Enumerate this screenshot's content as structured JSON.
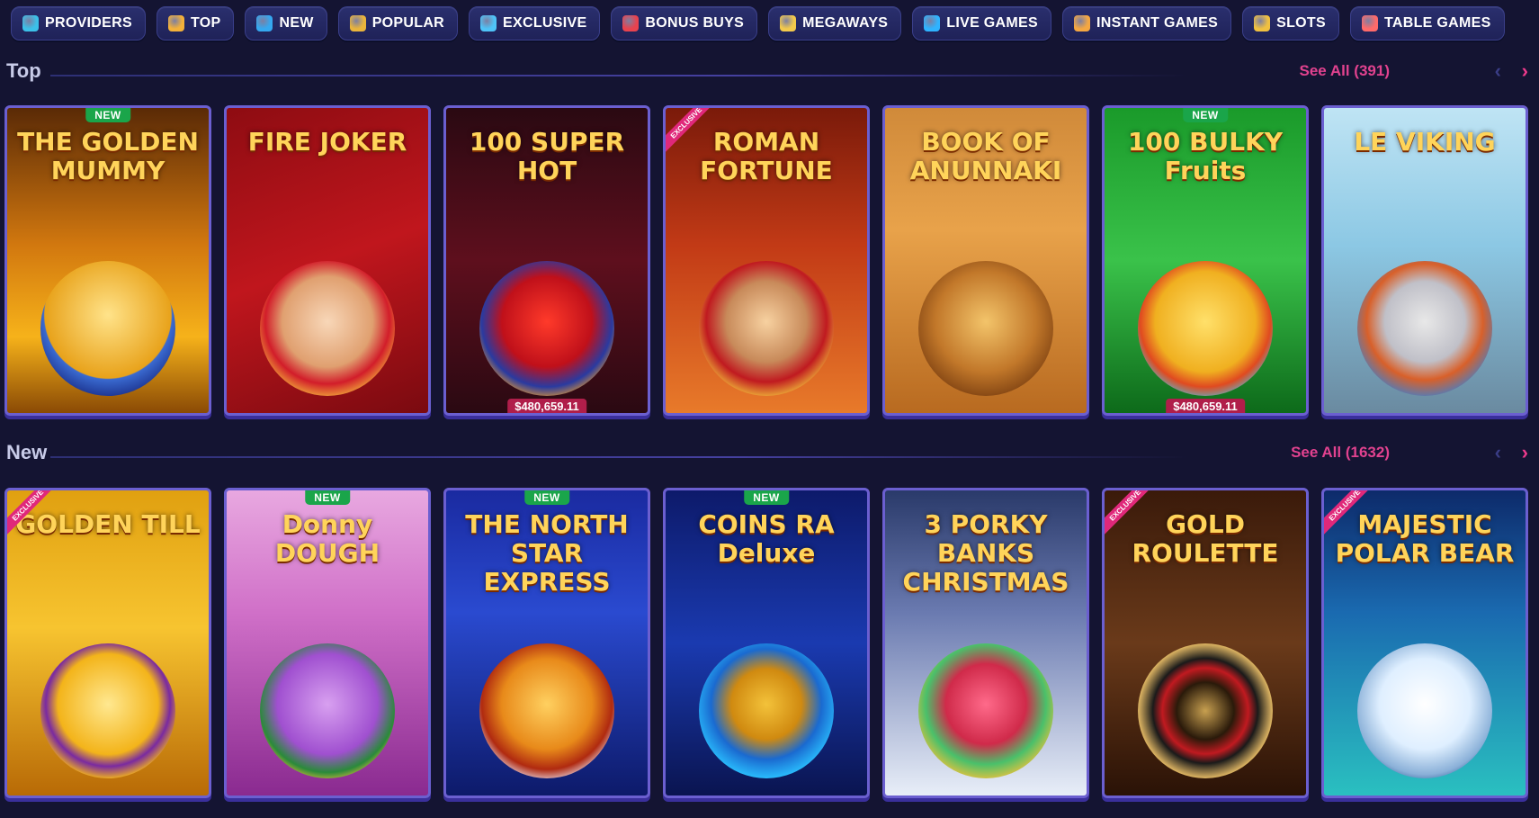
{
  "nav": {
    "items": [
      {
        "label": "PROVIDERS",
        "icon": "providers-icon",
        "color": "#3cc0e8"
      },
      {
        "label": "TOP",
        "icon": "trophy-icon",
        "color": "#f3b13a"
      },
      {
        "label": "NEW",
        "icon": "sparkle-icon",
        "color": "#35a8f0"
      },
      {
        "label": "POPULAR",
        "icon": "shield-star-icon",
        "color": "#e9b43c"
      },
      {
        "label": "EXCLUSIVE",
        "icon": "diamond-icon",
        "color": "#4fc3f7"
      },
      {
        "label": "BONUS BUYS",
        "icon": "gift-icon",
        "color": "#e8434f"
      },
      {
        "label": "MEGAWAYS",
        "icon": "megaways-icon",
        "color": "#f2c94c"
      },
      {
        "label": "LIVE GAMES",
        "icon": "live-icon",
        "color": "#2fb3ff"
      },
      {
        "label": "INSTANT GAMES",
        "icon": "joystick-icon",
        "color": "#f4a742"
      },
      {
        "label": "SLOTS",
        "icon": "slot-machine-icon",
        "color": "#f0c040"
      },
      {
        "label": "TABLE GAMES",
        "icon": "cards-icon",
        "color": "#ff6a6a"
      }
    ]
  },
  "sections": {
    "top": {
      "title": "Top",
      "see_all": "See All (391)",
      "games": [
        {
          "name": "THE GOLDEN MUMMY",
          "badge": "NEW",
          "jackpot": "",
          "bg": "linear-gradient(180deg,#5a2a06 0%,#d2780f 45%,#f6b21a 75%,#8a4a05 100%)",
          "art": "radial-gradient(circle at 50% 40%,#ffe38a,#e8a21a 60%,#3a6ad0 61%,#1a2f8a 80%)"
        },
        {
          "name": "FIRE JOKER",
          "badge": "",
          "jackpot": "",
          "bg": "linear-gradient(160deg,#8e0c12 0%,#c0161d 50%,#7a0a10 100%)",
          "art": "radial-gradient(circle at 50% 45%,#f8d7b8,#e0a070 45%,#d21d2a 62%,#f2b23a 78%)"
        },
        {
          "name": "100 SUPER HOT",
          "badge": "",
          "jackpot": "$480,659.11",
          "bg": "linear-gradient(180deg,#2a0912 0%,#5e0f1d 50%,#2a0912 100%)",
          "art": "radial-gradient(circle at 50% 45%,#ff3a2a,#c0101a 45%,#2a3aa0 65%,#f5a020 80%)"
        },
        {
          "name": "ROMAN FORTUNE",
          "badge": "EXCLUSIVE",
          "jackpot": "",
          "bg": "linear-gradient(180deg,#7a1a0a 0%,#c23a16 45%,#e87a2a 100%)",
          "art": "radial-gradient(circle at 50% 45%,#f7d1a0,#c88a5a 40%,#c01a20 60%,#f3c23a 78%)"
        },
        {
          "name": "BOOK OF ANUNNAKI",
          "badge": "",
          "jackpot": "",
          "bg": "linear-gradient(180deg,#d08a3a 0%,#e8a24a 40%,#b86a20 100%)",
          "art": "radial-gradient(circle at 50% 45%,#f3c46a,#c2782a 50%,#7a3e10 80%)"
        },
        {
          "name": "100 BULKY Fruits",
          "badge": "NEW",
          "jackpot": "$480,659.11",
          "bg": "linear-gradient(180deg,#1a9a2a 0%,#3ac24a 50%,#0d6a1a 100%)",
          "art": "radial-gradient(circle at 50% 45%,#ffe06a,#f0b020 50%,#e04a20 65%,#4ac0e0 80%)"
        },
        {
          "name": "LE VIKING",
          "badge": "",
          "jackpot": "",
          "bg": "linear-gradient(180deg,#bfe4f4 0%,#8cc8e4 45%,#6a8aa0 100%)",
          "art": "radial-gradient(circle at 50% 45%,#e8e8e8,#c0c0c8 40%,#d8602a 58%,#5a7ab0 75%)"
        }
      ]
    },
    "new": {
      "title": "New",
      "see_all": "See All (1632)",
      "games": [
        {
          "name": "GOLDEN TILL",
          "badge": "EXCLUSIVE",
          "jackpot": "",
          "bg": "linear-gradient(180deg,#e0a010 0%,#f7c430 45%,#b86a06 100%)",
          "art": "radial-gradient(circle at 50% 45%,#ffe890,#f3b41a 50%,#7a2aa0 62%,#f3b41a 75%)"
        },
        {
          "name": "Donny DOUGH",
          "badge": "NEW",
          "jackpot": "",
          "bg": "linear-gradient(180deg,#e8a8e0 0%,#d070c8 40%,#8a2a90 100%)",
          "art": "radial-gradient(circle at 50% 45%,#d8a0f0,#a050d0 50%,#2a8a3a 68%,#f3c23a 80%)"
        },
        {
          "name": "THE NORTH STAR EXPRESS",
          "badge": "NEW",
          "jackpot": "",
          "bg": "linear-gradient(180deg,#1a2aa0 0%,#2a4ad0 40%,#0d1a6a 100%)",
          "art": "radial-gradient(circle at 50% 45%,#ffd060,#e88a1a 45%,#b02a10 65%,#f0f0ff 80%)"
        },
        {
          "name": "COINS RA Deluxe",
          "badge": "NEW",
          "jackpot": "",
          "bg": "linear-gradient(180deg,#0d1a6a 0%,#1a3ab0 50%,#0a1450 100%)",
          "art": "radial-gradient(circle at 50% 45%,#f3c23a,#d08a10 35%,#1a6ad0 55%,#2ac0ff 75%)"
        },
        {
          "name": "3 PORKY BANKS CHRISTMAS",
          "badge": "",
          "jackpot": "",
          "bg": "linear-gradient(180deg,#2a3a6a 0%,#6a7ab0 40%,#e8eef8 100%)",
          "art": "radial-gradient(circle at 50% 45%,#ff6a8a,#d02a4a 40%,#4ac06a 60%,#f3c23a 78%)"
        },
        {
          "name": "GOLD ROULETTE",
          "badge": "EXCLUSIVE",
          "jackpot": "",
          "bg": "linear-gradient(180deg,#3a1a0a 0%,#6a3a1a 50%,#2a1206 100%)",
          "art": "radial-gradient(circle at 50% 50%,#c8a050,#2a1a0a 30%,#c01a20 45%,#1a1a1a 55%,#d8b060 70%,#3a2a10 80%)"
        },
        {
          "name": "MAJESTIC POLAR BEAR",
          "badge": "EXCLUSIVE",
          "jackpot": "",
          "bg": "linear-gradient(180deg,#0d2a6a 0%,#1a6ab0 40%,#2ac0c0 100%)",
          "art": "radial-gradient(circle at 50% 45%,#ffffff,#dfefff 45%,#8ab0d8 70%,#1a4a8a 85%)"
        }
      ]
    }
  },
  "colors": {
    "accent": "#e2428f",
    "background": "#141432",
    "tile_border": "#6b5fd0",
    "new_badge": "#1aa54a"
  }
}
